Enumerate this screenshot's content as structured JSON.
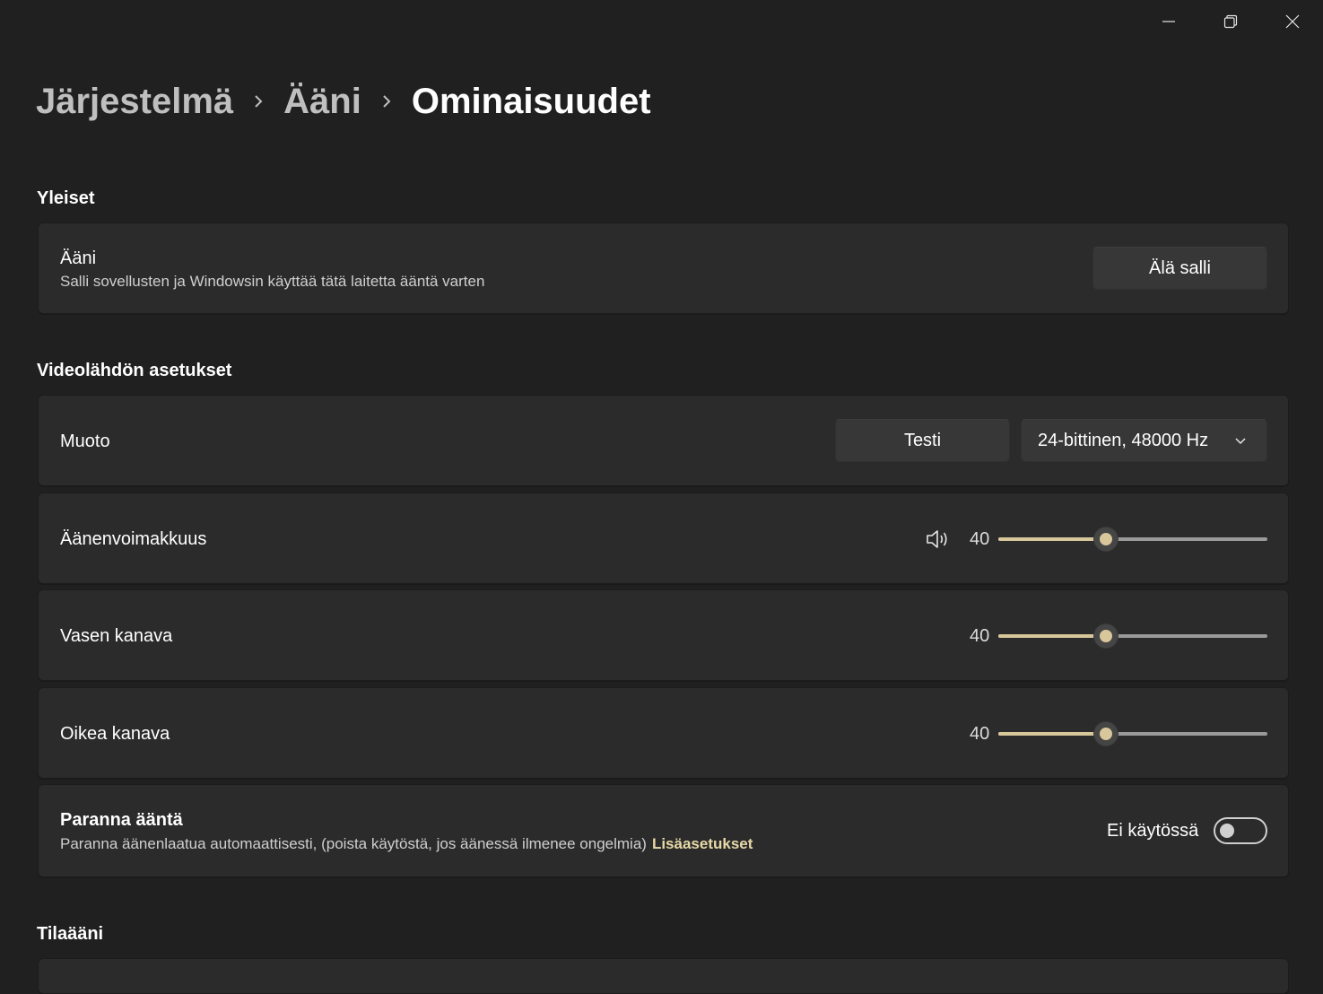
{
  "breadcrumb": {
    "items": [
      "Järjestelmä",
      "Ääni"
    ],
    "current": "Ominaisuudet"
  },
  "window_controls": {
    "minimize": "minimize-icon",
    "restore": "restore-icon",
    "close": "close-icon"
  },
  "sections": {
    "general": {
      "header": "Yleiset",
      "audio": {
        "title": "Ääni",
        "description": "Salli sovellusten ja Windowsin käyttää tätä laitetta ääntä varten",
        "button": "Älä salli"
      }
    },
    "video_source": {
      "header": "Videolähdön asetukset",
      "format": {
        "label": "Muoto",
        "test_button": "Testi",
        "selected": "24-bittinen, 48000 Hz"
      },
      "volume": {
        "label": "Äänenvoimakkuus",
        "value": "40",
        "icon": "speaker-icon",
        "percent": 40
      },
      "left_channel": {
        "label": "Vasen kanava",
        "value": "40",
        "percent": 40
      },
      "right_channel": {
        "label": "Oikea kanava",
        "value": "40",
        "percent": 40
      },
      "enhance": {
        "title": "Paranna ääntä",
        "description": "Paranna äänenlaatua automaattisesti, (poista käytöstä, jos äänessä ilmenee ongelmia)",
        "link": "Lisäasetukset",
        "state_label": "Ei käytössä",
        "enabled": false
      }
    },
    "spatial": {
      "header": "Tilaääni"
    }
  },
  "colors": {
    "background": "#202020",
    "card": "#2b2b2b",
    "accent": "#d8c79a"
  }
}
